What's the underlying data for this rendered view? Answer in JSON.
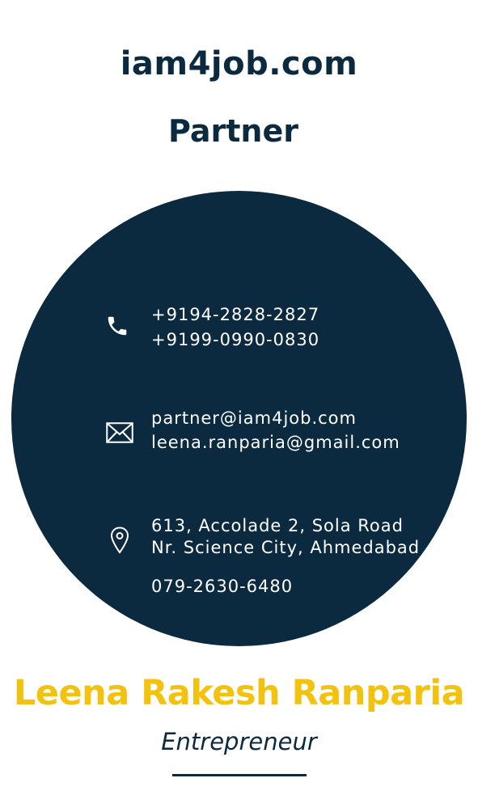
{
  "header": {
    "brand": "iam4job.com",
    "role": "Partner"
  },
  "contact": {
    "phones": [
      "+9194-2828-2827",
      "+9199-0990-0830"
    ],
    "emails": [
      "partner@iam4job.com",
      "leena.ranparia@gmail.com"
    ],
    "address": [
      "613, Accolade 2, Sola Road",
      "Nr. Science City, Ahmedabad"
    ],
    "landline": "079-2630-6480"
  },
  "person": {
    "name": "Leena Rakesh Ranparia",
    "title": "Entrepreneur"
  },
  "colors": {
    "navy": "#0b2a3f",
    "accent": "#f2c20f",
    "background": "#ffffff"
  },
  "icons": {
    "phone": "phone-icon",
    "email": "envelope-icon",
    "location": "location-pin-icon"
  }
}
